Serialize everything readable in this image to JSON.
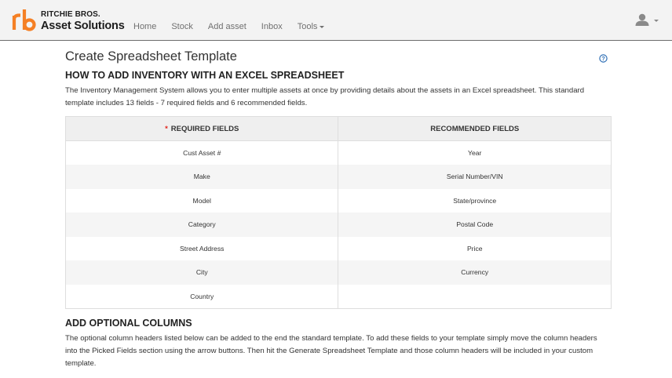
{
  "brand": {
    "line1": "RITCHIE BROS.",
    "line2": "Asset Solutions",
    "accent": "#f58025"
  },
  "nav": {
    "items": [
      {
        "label": "Home"
      },
      {
        "label": "Stock"
      },
      {
        "label": "Add asset"
      },
      {
        "label": "Inbox"
      },
      {
        "label": "Tools"
      }
    ],
    "user_icon": "user-icon"
  },
  "page": {
    "title": "Create Spreadsheet Template",
    "help_icon": "question-circle-icon"
  },
  "how_to": {
    "heading": "HOW TO ADD INVENTORY WITH AN EXCEL SPREADSHEET",
    "text": "The Inventory Management System allows you to enter multiple assets at once by providing details about the assets in an Excel spreadsheet. This standard template includes 13 fields - 7 required fields and 6 recommended fields."
  },
  "fields_table": {
    "required_marker": "*",
    "headers": {
      "required": "REQUIRED FIELDS",
      "recommended": "RECOMMENDED FIELDS"
    },
    "rows": [
      {
        "required": "Cust Asset #",
        "recommended": "Year"
      },
      {
        "required": "Make",
        "recommended": "Serial Number/VIN"
      },
      {
        "required": "Model",
        "recommended": "State/province"
      },
      {
        "required": "Category",
        "recommended": "Postal Code"
      },
      {
        "required": "Street Address",
        "recommended": "Price"
      },
      {
        "required": "City",
        "recommended": "Currency"
      },
      {
        "required": "Country",
        "recommended": ""
      }
    ]
  },
  "optional": {
    "heading": "ADD OPTIONAL COLUMNS",
    "text": "The optional column headers listed below can be added to the end the standard template. To add these fields to your template simply move the column headers into the Picked Fields section using the arrow buttons. Then hit the Generate Spreadsheet Template and those column headers will be included in your custom template."
  }
}
